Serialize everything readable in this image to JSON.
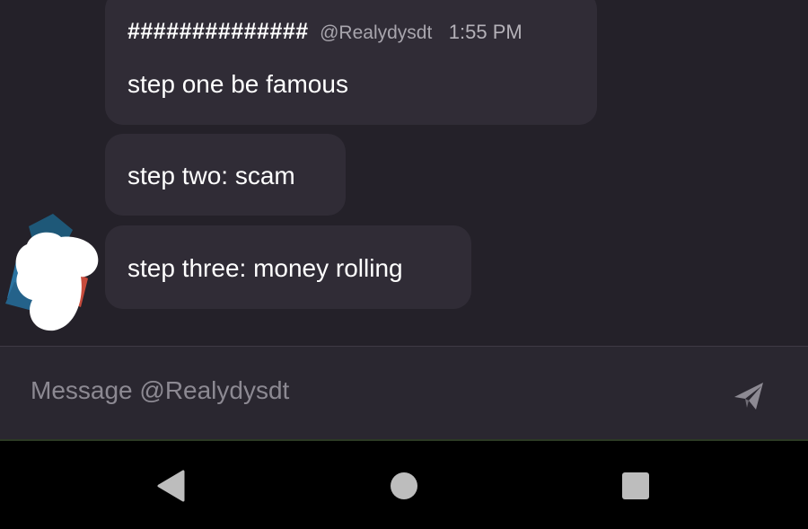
{
  "messages": [
    {
      "author": "##############",
      "handle": "@Realydysdt",
      "time": "1:55 PM",
      "text": "step one be famous"
    },
    {
      "text": "step two: scam"
    },
    {
      "text": "step three: money rolling"
    }
  ],
  "composer": {
    "placeholder": "Message @Realydysdt",
    "send_icon": "send-icon"
  },
  "navbar": {
    "back_icon": "back-icon",
    "home_icon": "home-icon",
    "recents_icon": "recents-icon"
  },
  "colors": {
    "background": "#242129",
    "bubble": "#302c36",
    "composer": "#2a2730",
    "text": "#ffffff",
    "muted_text": "#a8a5ad",
    "placeholder": "#8c8992",
    "navbar": "#000000",
    "nav_icon": "#bdbdbd"
  }
}
